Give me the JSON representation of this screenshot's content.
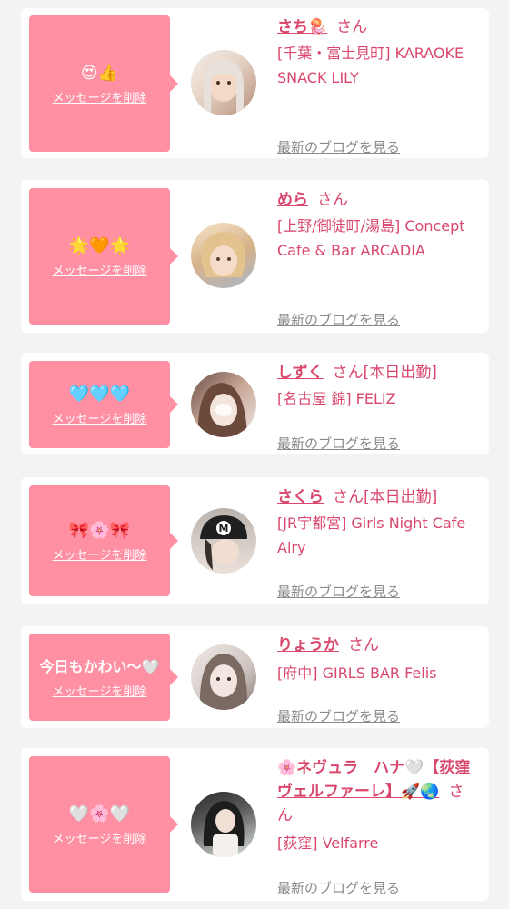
{
  "delete_label": "メッセージを削除",
  "san": "さん",
  "blog_label": "最新のブログを見る",
  "items": [
    {
      "message": "😍👍",
      "name": "さち🪼",
      "status": "",
      "shop": "[千葉・富士見町] KARAOKE SNACK LILY"
    },
    {
      "message": "🌟🧡🌟",
      "name": "めら",
      "status": "",
      "shop": "[上野/御徒町/湯島] Concept Cafe & Bar ARCADIA"
    },
    {
      "message": "🩵🩵🩵",
      "name": "しずく",
      "status": "[本日出勤]",
      "shop": "[名古屋 錦] FELIZ"
    },
    {
      "message": "🎀🌸🎀",
      "name": "さくら",
      "status": "[本日出勤]",
      "shop": "[JR宇都宮] Girls Night Cafe Airy"
    },
    {
      "message": "今日もかわい〜🤍",
      "name": "りょうか",
      "status": "",
      "shop": "[府中] GIRLS BAR Felis"
    },
    {
      "message": "🤍🌸🤍",
      "name": "🌸ネヴュラ　ハナ🤍【荻窪ヴェルファーレ】🚀🌏",
      "status": "",
      "shop": "[荻窪] Velfarre"
    }
  ],
  "colors": {
    "accent": "#d9476c",
    "bubble": "#ff8fa3",
    "link_gray": "#8a8a8a"
  }
}
